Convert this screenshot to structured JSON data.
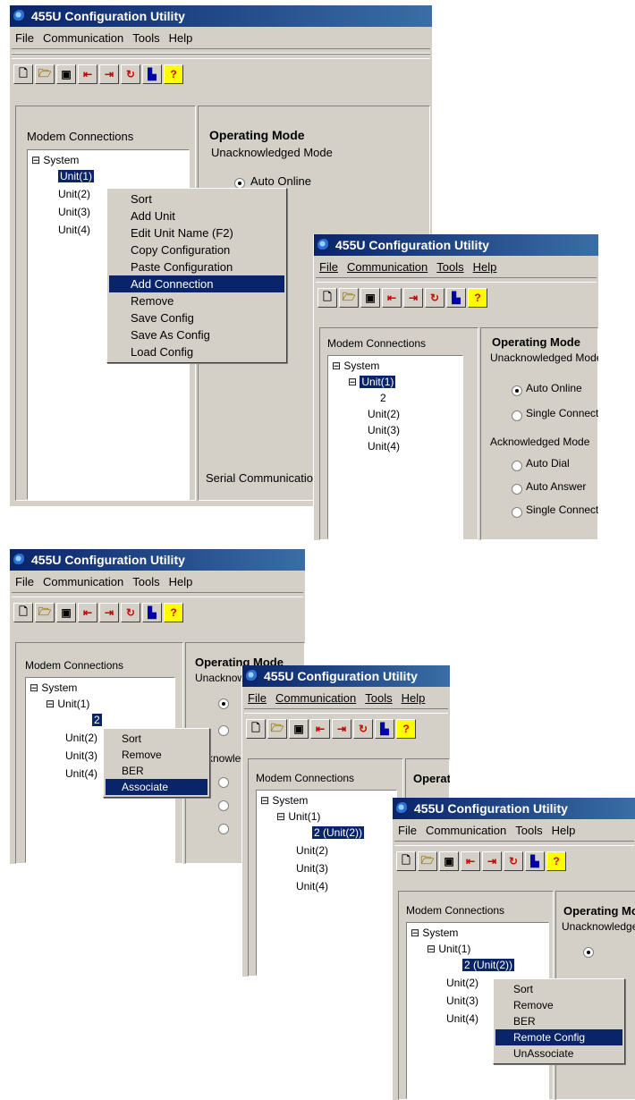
{
  "app_title": "455U Configuration Utility",
  "menu": [
    "File",
    "Communication",
    "Tools",
    "Help"
  ],
  "panel_label": "Modem Connections",
  "system_label": "System",
  "operating_mode": "Operating Mode",
  "unack_mode": "Unacknowledged Mode",
  "ack_mode": "Acknowledged Mode",
  "radios": [
    "Auto Online",
    "Single Connect",
    "Auto Dial",
    "Auto Answer",
    "Single Connect"
  ],
  "serial_comm": "Serial Communications",
  "units": [
    "Unit(1)",
    "Unit(2)",
    "Unit(3)",
    "Unit(4)"
  ],
  "child_2": "2",
  "child_2_assoc": "2 (Unit(2))",
  "menu1": [
    "Sort",
    "Add Unit",
    "Edit Unit Name (F2)",
    "Copy Configuration",
    "Paste Configuration",
    "Add Connection",
    "Remove",
    "Save Config",
    "Save As Config",
    "Load Config"
  ],
  "menu1_highlight": "Add Connection",
  "menu2": [
    "Sort",
    "Remove",
    "BER",
    "Associate"
  ],
  "menu3": [
    "Sort",
    "Remove",
    "BER",
    "Remote Config",
    "UnAssociate"
  ],
  "toolbar_icons": [
    "new-icon",
    "open-icon",
    "save-icon",
    "upload-icon",
    "download-icon",
    "reset-icon",
    "chart-icon",
    "help-icon"
  ]
}
